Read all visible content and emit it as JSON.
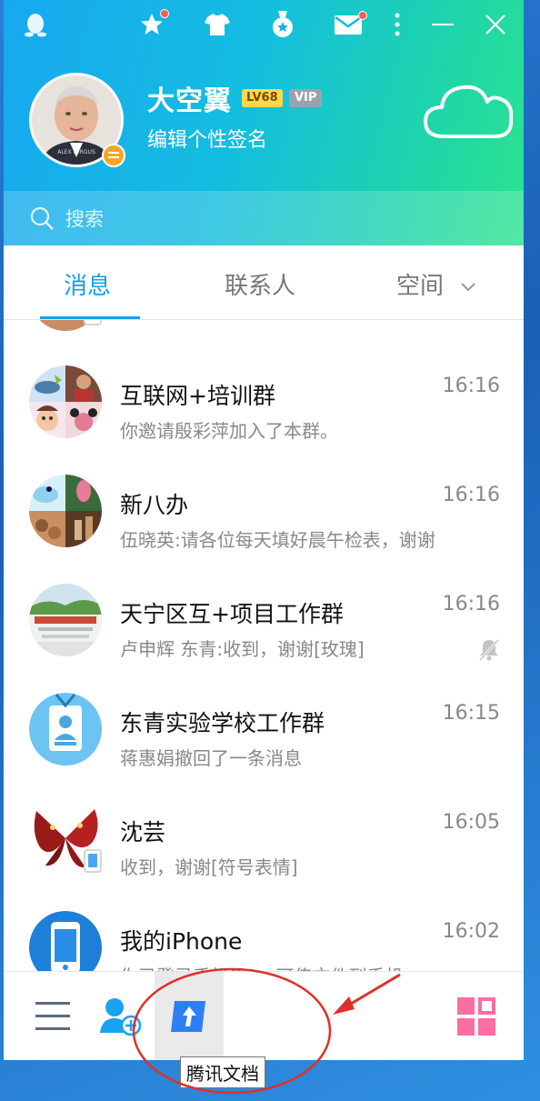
{
  "header": {
    "nickname": "大空翼",
    "level_badge": "LV68",
    "vip_badge": "VIP",
    "signature": "编辑个性签名",
    "avatar_caption": "ALEX FERGUS"
  },
  "search": {
    "placeholder": "搜索"
  },
  "tabs": [
    {
      "label": "消息",
      "active": true
    },
    {
      "label": "联系人",
      "active": false
    },
    {
      "label": "空间",
      "active": false
    }
  ],
  "conversations": [
    {
      "name": "互联网+培训群",
      "time": "16:16",
      "preview": "你邀请殷彩萍加入了本群。"
    },
    {
      "name": "新八办",
      "time": "16:16",
      "preview": "伍晓英:请各位每天填好晨午检表，谢谢"
    },
    {
      "name": "天宁区互+项目工作群",
      "time": "16:16",
      "preview": "卢申辉 东青:收到，谢谢[玫瑰]",
      "muted": true
    },
    {
      "name": "东青实验学校工作群",
      "time": "16:15",
      "preview": "蒋惠娟撤回了一条消息"
    },
    {
      "name": "沈芸",
      "time": "16:05",
      "preview": "收到，谢谢[符号表情]"
    },
    {
      "name": "我的iPhone",
      "time": "16:02",
      "preview": "你已登录手机QQ，可传文件到手机。"
    }
  ],
  "bottom_bar": {
    "tooltip": "腾讯文档"
  },
  "colors": {
    "accent": "#12a0e8",
    "annotation": "#e0302a"
  }
}
